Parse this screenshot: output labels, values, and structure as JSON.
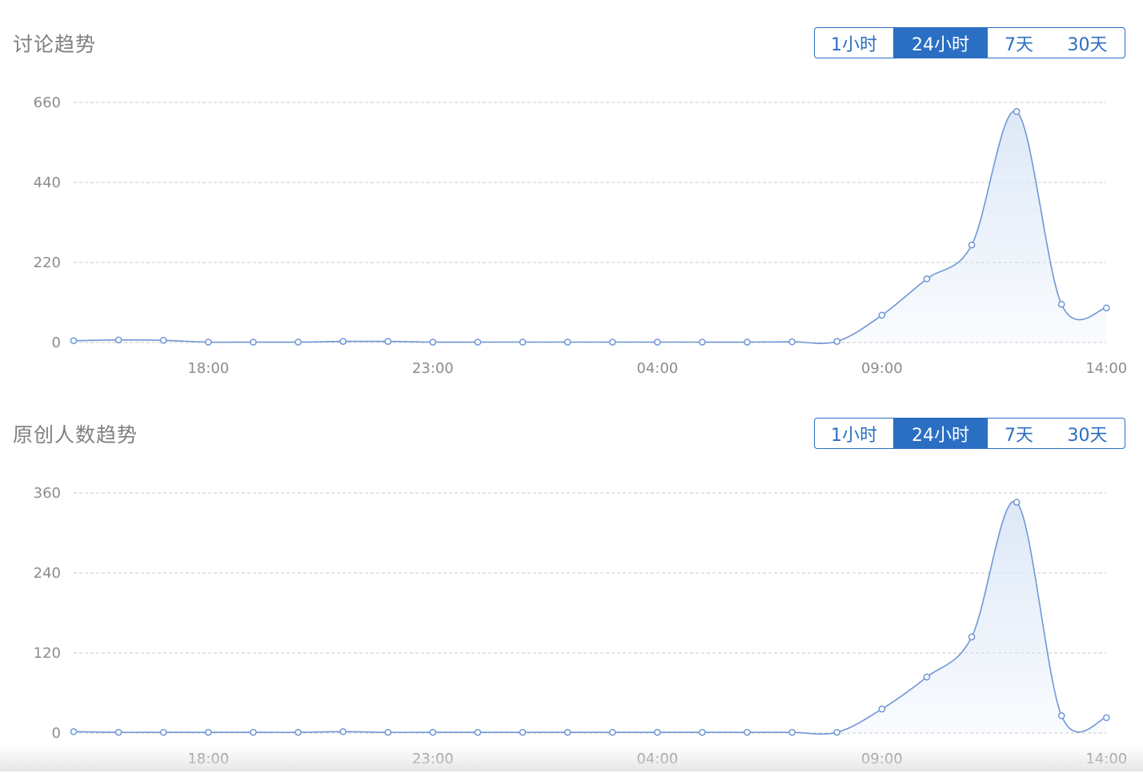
{
  "range_options": [
    "1小时",
    "24小时",
    "7天",
    "30天"
  ],
  "selected_range": "24小时",
  "colors": {
    "accent": "#2a6fc3",
    "line": "#6f97d6",
    "fill": "#dbe7f7",
    "grid": "#c8c8c8",
    "text": "#8c8c8c"
  },
  "chart_data": [
    {
      "type": "area",
      "title": "讨论趋势",
      "xlabel": "",
      "ylabel": "",
      "x_tick_labels": [
        "18:00",
        "23:00",
        "04:00",
        "09:00",
        "14:00"
      ],
      "y_ticks": [
        0,
        220,
        440,
        660
      ],
      "ylim": [
        0,
        660
      ],
      "grid": true,
      "values": [
        5,
        7,
        6,
        1,
        1,
        1,
        3,
        3,
        1,
        1,
        1,
        1,
        1,
        1,
        1,
        1,
        2,
        3,
        75,
        175,
        268,
        635,
        105,
        95
      ]
    },
    {
      "type": "area",
      "title": "原创人数趋势",
      "xlabel": "",
      "ylabel": "",
      "x_tick_labels": [
        "18:00",
        "23:00",
        "04:00",
        "09:00",
        "14:00"
      ],
      "y_ticks": [
        0,
        120,
        240,
        360
      ],
      "ylim": [
        0,
        360
      ],
      "grid": true,
      "values": [
        2,
        1,
        1,
        1,
        1,
        1,
        2,
        1,
        1,
        1,
        1,
        1,
        1,
        1,
        1,
        1,
        1,
        1,
        36,
        84,
        144,
        346,
        26,
        23
      ]
    }
  ]
}
